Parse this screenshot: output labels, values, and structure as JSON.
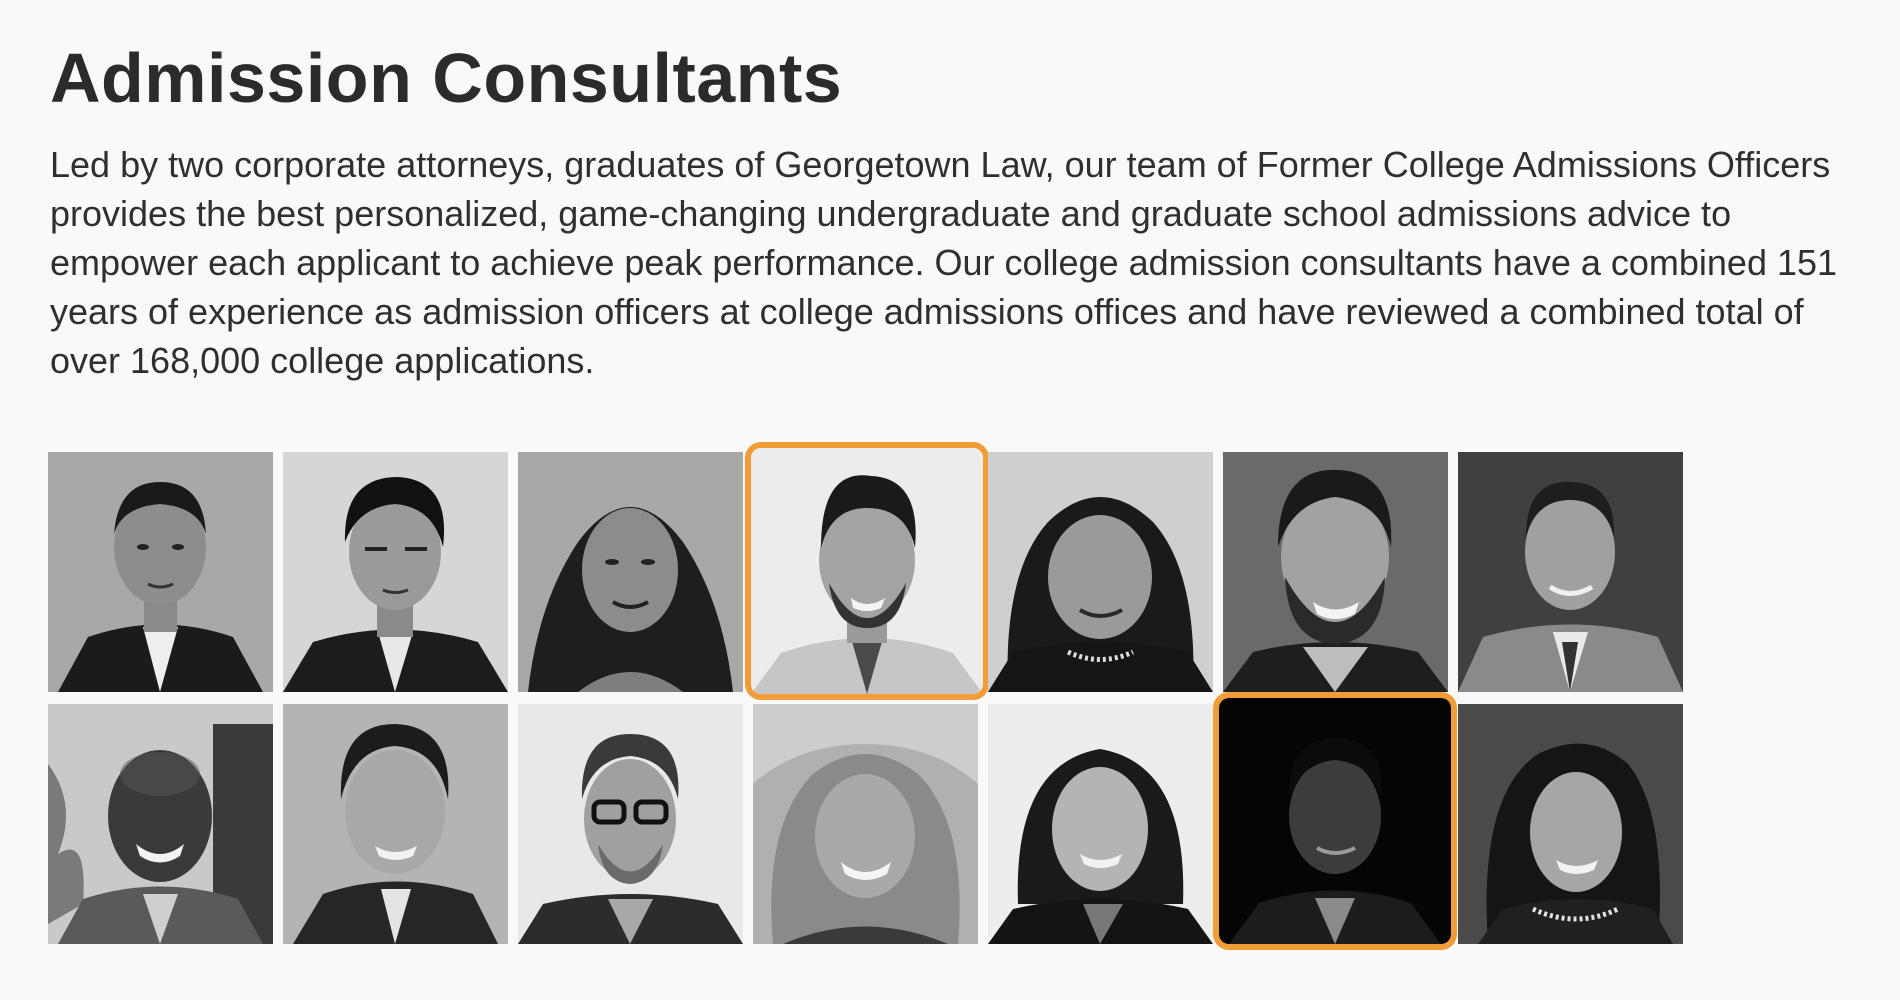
{
  "page": {
    "title": "Admission Consultants",
    "intro": "Led by two corporate attorneys, graduates of Georgetown Law, our team of Former College Admissions Officers provides the best personalized, game-changing undergraduate and graduate school admissions advice to empower each applicant to achieve peak performance. Our college admission consultants have a combined 151 years of experience as admission officers at college admissions offices and have reviewed a combined total of over 168,000 college applications."
  },
  "colors": {
    "accent": "#f29c38",
    "background": "#f9f9f9",
    "text": "#2b2b2b"
  },
  "consultants": [
    {
      "row": 1,
      "col": 1,
      "selected": false
    },
    {
      "row": 1,
      "col": 2,
      "selected": false
    },
    {
      "row": 1,
      "col": 3,
      "selected": false
    },
    {
      "row": 1,
      "col": 4,
      "selected": true
    },
    {
      "row": 1,
      "col": 5,
      "selected": false
    },
    {
      "row": 1,
      "col": 6,
      "selected": false
    },
    {
      "row": 1,
      "col": 7,
      "selected": false
    },
    {
      "row": 2,
      "col": 1,
      "selected": false
    },
    {
      "row": 2,
      "col": 2,
      "selected": false
    },
    {
      "row": 2,
      "col": 3,
      "selected": false
    },
    {
      "row": 2,
      "col": 4,
      "selected": false
    },
    {
      "row": 2,
      "col": 5,
      "selected": false
    },
    {
      "row": 2,
      "col": 6,
      "selected": true
    },
    {
      "row": 2,
      "col": 7,
      "selected": false
    }
  ]
}
